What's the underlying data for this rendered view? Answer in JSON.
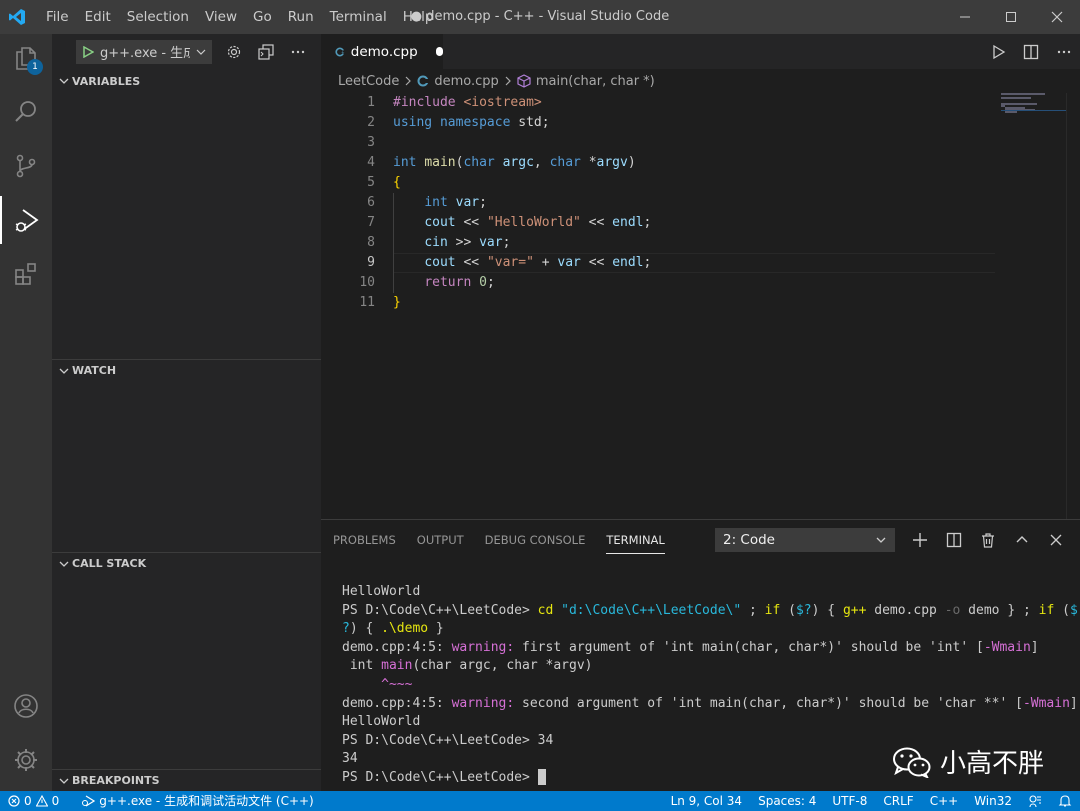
{
  "titlebar": {
    "menu": [
      "File",
      "Edit",
      "Selection",
      "View",
      "Go",
      "Run",
      "Terminal",
      "Help"
    ],
    "title": "● demo.cpp - C++ - Visual Studio Code"
  },
  "activity": {
    "explorer_badge": "1"
  },
  "sidebar": {
    "config_label": "g++.exe - 生成",
    "sections": {
      "variables": "VARIABLES",
      "watch": "WATCH",
      "call_stack": "CALL STACK",
      "breakpoints": "BREAKPOINTS"
    }
  },
  "tab": {
    "name": "demo.cpp"
  },
  "breadcrumbs": {
    "folder": "LeetCode",
    "file": "demo.cpp",
    "symbol": "main(char, char *)"
  },
  "editor": {
    "line_numbers": [
      "1",
      "2",
      "3",
      "4",
      "5",
      "6",
      "7",
      "8",
      "9",
      "10",
      "11"
    ],
    "lines": [
      [
        {
          "t": "#include ",
          "c": "pp"
        },
        {
          "t": "<iostream>",
          "c": "st"
        }
      ],
      [
        {
          "t": "using",
          "c": "kw"
        },
        {
          "t": " ",
          "c": ""
        },
        {
          "t": "namespace",
          "c": "kw"
        },
        {
          "t": " std;",
          "c": ""
        }
      ],
      [],
      [
        {
          "t": "int",
          "c": "ty"
        },
        {
          "t": " ",
          "c": ""
        },
        {
          "t": "main",
          "c": "fn"
        },
        {
          "t": "(",
          "c": ""
        },
        {
          "t": "char",
          "c": "ty"
        },
        {
          "t": " ",
          "c": ""
        },
        {
          "t": "argc",
          "c": "vr"
        },
        {
          "t": ", ",
          "c": ""
        },
        {
          "t": "char",
          "c": "ty"
        },
        {
          "t": " *",
          "c": ""
        },
        {
          "t": "argv",
          "c": "vr"
        },
        {
          "t": ")",
          "c": ""
        }
      ],
      [
        {
          "t": "{",
          "c": "br"
        }
      ],
      [
        {
          "t": "    ",
          "c": ""
        },
        {
          "t": "int",
          "c": "ty"
        },
        {
          "t": " ",
          "c": ""
        },
        {
          "t": "var",
          "c": "vr"
        },
        {
          "t": ";",
          "c": ""
        }
      ],
      [
        {
          "t": "    ",
          "c": ""
        },
        {
          "t": "cout",
          "c": "vr"
        },
        {
          "t": " << ",
          "c": ""
        },
        {
          "t": "\"HelloWorld\"",
          "c": "st"
        },
        {
          "t": " << ",
          "c": ""
        },
        {
          "t": "endl",
          "c": "vr"
        },
        {
          "t": ";",
          "c": ""
        }
      ],
      [
        {
          "t": "    ",
          "c": ""
        },
        {
          "t": "cin",
          "c": "vr"
        },
        {
          "t": " >> ",
          "c": ""
        },
        {
          "t": "var",
          "c": "vr"
        },
        {
          "t": ";",
          "c": ""
        }
      ],
      [
        {
          "t": "    ",
          "c": ""
        },
        {
          "t": "cout",
          "c": "vr"
        },
        {
          "t": " << ",
          "c": ""
        },
        {
          "t": "\"var=\"",
          "c": "st"
        },
        {
          "t": " + ",
          "c": ""
        },
        {
          "t": "var",
          "c": "vr"
        },
        {
          "t": " << ",
          "c": ""
        },
        {
          "t": "endl",
          "c": "vr"
        },
        {
          "t": ";",
          "c": ""
        }
      ],
      [
        {
          "t": "    ",
          "c": ""
        },
        {
          "t": "return",
          "c": "pp"
        },
        {
          "t": " ",
          "c": ""
        },
        {
          "t": "0",
          "c": "nm"
        },
        {
          "t": ";",
          "c": ""
        }
      ],
      [
        {
          "t": "}",
          "c": "br"
        }
      ]
    ]
  },
  "panel": {
    "tabs": [
      "PROBLEMS",
      "OUTPUT",
      "DEBUG CONSOLE",
      "TERMINAL"
    ],
    "active_tab": "TERMINAL",
    "terminal_select": "2: Code"
  },
  "terminal": [
    [
      {
        "t": "HelloWorld",
        "c": ""
      }
    ],
    [
      {
        "t": "PS D:\\Code\\C++\\LeetCode> ",
        "c": ""
      },
      {
        "t": "cd ",
        "c": "tyl"
      },
      {
        "t": "\"d:\\Code\\C++\\LeetCode\\\"",
        "c": "tcy"
      },
      {
        "t": " ; ",
        "c": ""
      },
      {
        "t": "if",
        "c": "tyl"
      },
      {
        "t": " (",
        "c": ""
      },
      {
        "t": "$?",
        "c": "tcy"
      },
      {
        "t": ") { ",
        "c": ""
      },
      {
        "t": "g++",
        "c": "tyl"
      },
      {
        "t": " demo.cpp ",
        "c": ""
      },
      {
        "t": "-o",
        "c": "tgy"
      },
      {
        "t": " demo } ; ",
        "c": ""
      },
      {
        "t": "if",
        "c": "tyl"
      },
      {
        "t": " (",
        "c": ""
      },
      {
        "t": "$",
        "c": "tcy"
      }
    ],
    [
      {
        "t": "?",
        "c": "tcy"
      },
      {
        "t": ") { ",
        "c": ""
      },
      {
        "t": ".\\demo",
        "c": "tyl"
      },
      {
        "t": " }",
        "c": ""
      }
    ],
    [
      {
        "t": "demo.cpp:4:5: ",
        "c": ""
      },
      {
        "t": "warning: ",
        "c": "tmg"
      },
      {
        "t": "first argument of 'int main(char, char*)' should be 'int' [",
        "c": ""
      },
      {
        "t": "-Wmain",
        "c": "tmg"
      },
      {
        "t": "]",
        "c": ""
      }
    ],
    [
      {
        "t": " int ",
        "c": ""
      },
      {
        "t": "main",
        "c": "tmg"
      },
      {
        "t": "(char argc, char *argv)",
        "c": ""
      }
    ],
    [
      {
        "t": "     ^~~~",
        "c": "tmg"
      }
    ],
    [
      {
        "t": "demo.cpp:4:5: ",
        "c": ""
      },
      {
        "t": "warning: ",
        "c": "tmg"
      },
      {
        "t": "second argument of 'int main(char, char*)' should be 'char **' [",
        "c": ""
      },
      {
        "t": "-Wmain",
        "c": "tmg"
      },
      {
        "t": "]",
        "c": ""
      }
    ],
    [
      {
        "t": "HelloWorld",
        "c": ""
      }
    ],
    [
      {
        "t": "PS D:\\Code\\C++\\LeetCode> 34",
        "c": ""
      }
    ],
    [
      {
        "t": "34",
        "c": ""
      }
    ],
    [
      {
        "t": "PS D:\\Code\\C++\\LeetCode> ",
        "c": ""
      }
    ]
  ],
  "watermark": "小高不胖",
  "statusbar": {
    "errors": "0",
    "warnings": "0",
    "debug_config": "g++.exe - 生成和调试活动文件 (C++)",
    "position": "Ln 9, Col 34",
    "spaces": "Spaces: 4",
    "encoding": "UTF-8",
    "eol": "CRLF",
    "language": "C++",
    "platform": "Win32"
  },
  "colors": {
    "accent": "#007acc",
    "background": "#1e1e1e",
    "sidebar": "#252526",
    "activitybar": "#333333"
  }
}
